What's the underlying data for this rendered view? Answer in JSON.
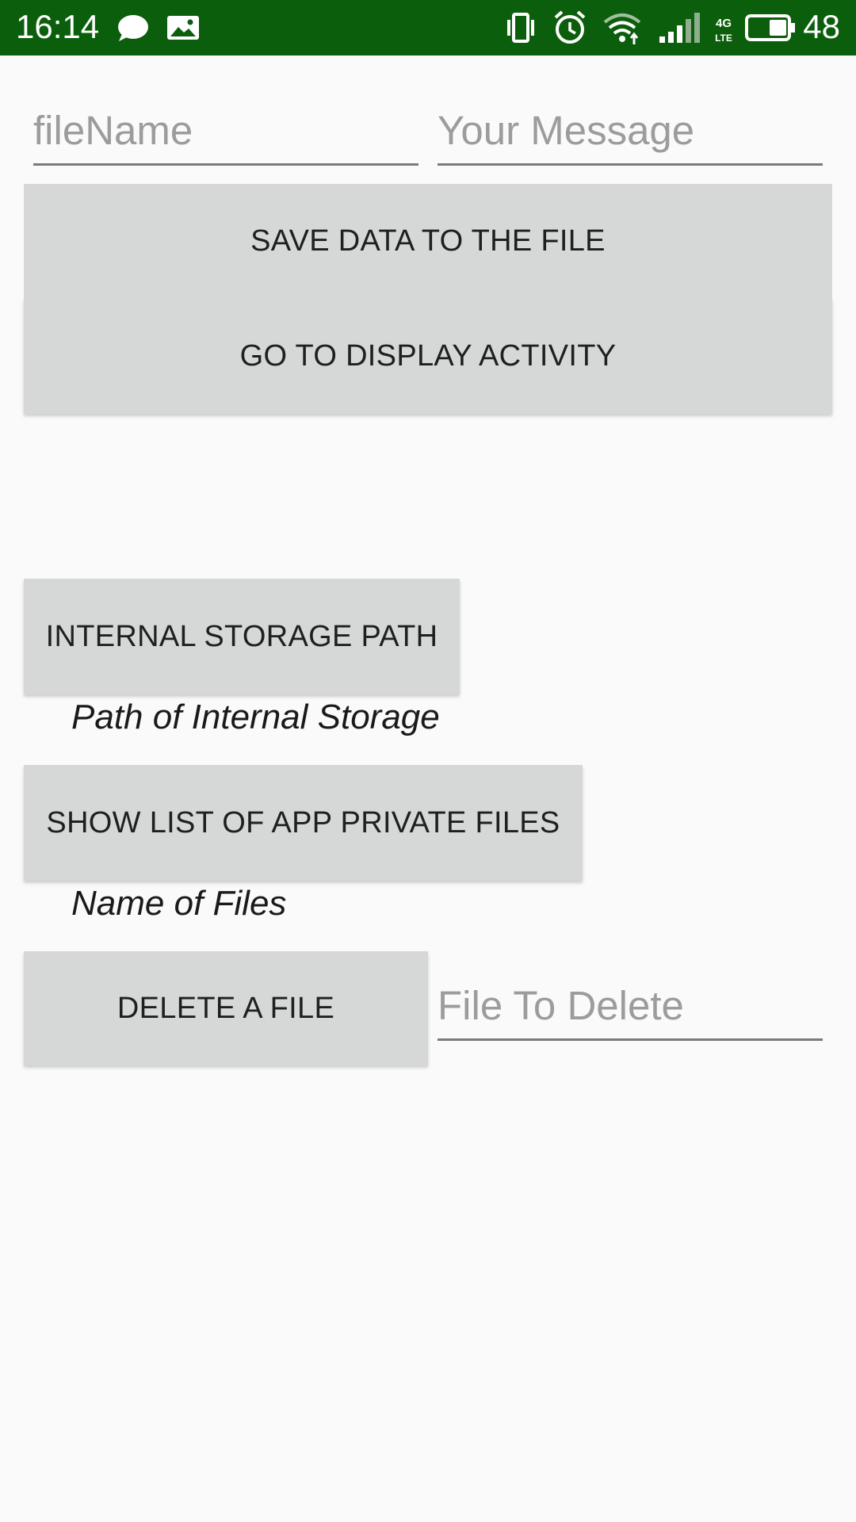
{
  "status_bar": {
    "time": "16:14",
    "battery": "48",
    "background_color": "#0b5e0b",
    "icons": [
      "chat-bubble-icon",
      "image-icon",
      "vibrate-icon",
      "alarm-icon",
      "wifi-icon",
      "signal-icon",
      "4g-lte-icon",
      "battery-icon"
    ]
  },
  "form": {
    "filename_placeholder": "fileName",
    "message_placeholder": "Your Message",
    "save_button": "SAVE DATA TO THE FILE",
    "display_button": "GO TO DISPLAY ACTIVITY",
    "internal_storage_button": "INTERNAL STORAGE PATH",
    "internal_storage_label": "Path of Internal Storage",
    "show_files_button": "SHOW LIST OF APP PRIVATE FILES",
    "files_label": "Name of Files",
    "delete_button": "DELETE A FILE",
    "delete_placeholder": "File To Delete"
  }
}
